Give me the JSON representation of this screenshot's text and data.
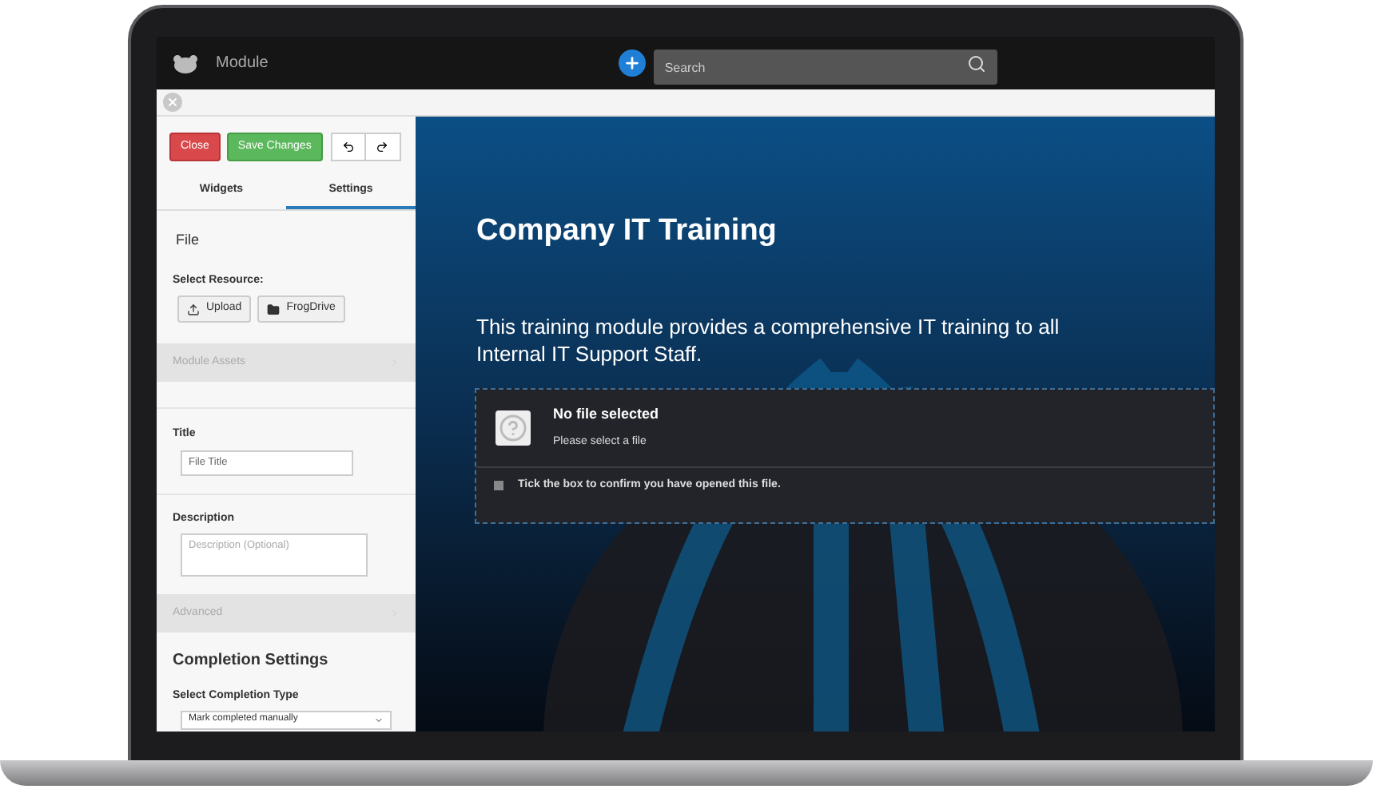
{
  "app_bar": {
    "title": "Module",
    "search": {
      "placeholder": "Search"
    }
  },
  "editor": {
    "buttons": [
      {
        "label": "Close",
        "kind": "danger"
      },
      {
        "label": "Save Changes",
        "kind": "success"
      }
    ],
    "tabs": [
      {
        "label": "Widgets",
        "selected": false
      },
      {
        "label": "Settings",
        "selected": true
      }
    ],
    "file_heading": "File",
    "resource_label": "Select Resource:",
    "resource_buttons": [
      {
        "label": "Upload",
        "kind": "upload"
      },
      {
        "label": "FrogDrive",
        "kind": "folder"
      }
    ],
    "module_assets": "Module Assets",
    "title_label": "Title",
    "title_field": {
      "placeholder": "File Title"
    },
    "description_label": "Description",
    "description_field": {
      "placeholder": "Description (Optional)"
    },
    "advanced": "Advanced",
    "completion_heading": "Completion Settings",
    "completion_type_label": "Select Completion Type",
    "completion_type_value": "Mark completed manually"
  },
  "content": {
    "title": "Company IT Training",
    "description": "This training module provides a comprehensive IT training to all Internal IT Support Staff.",
    "file_card": {
      "title": "No file selected",
      "subtitle": "Please select a file",
      "confirm": {
        "label": "Tick the box to confirm you have opened this file.",
        "checked": false
      }
    }
  }
}
